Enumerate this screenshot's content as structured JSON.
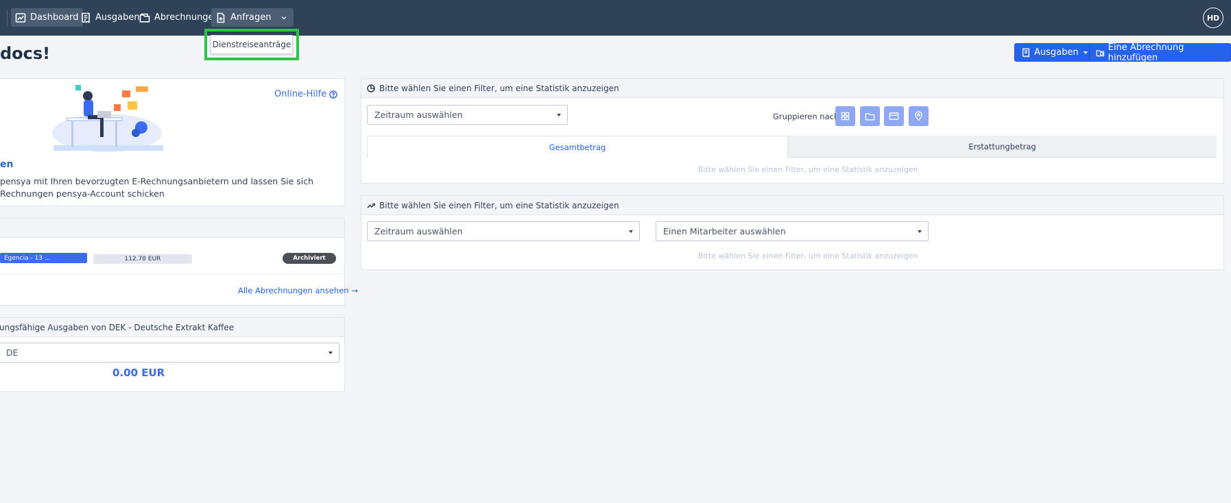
{
  "nav": {
    "items": [
      {
        "label": "Dashboard",
        "icon": "dashboard-icon"
      },
      {
        "label": "Ausgaben",
        "icon": "receipt-icon"
      },
      {
        "label": "Abrechnungen",
        "icon": "folder-icon"
      },
      {
        "label": "Anfragen",
        "icon": "document-plus-icon"
      }
    ],
    "avatar": "HD",
    "dropdown_item": "Dienstreiseanträge"
  },
  "page": {
    "title": "docs!",
    "expenses_button": "Ausgaben",
    "add_report_button": "Eine Abrechnung hinzufügen"
  },
  "einvoice": {
    "help_link": "Online-Hilfe",
    "title": "en",
    "text": "pensya mit Ihren bevorzugten E-Rechnungsanbietern und lassen Sie sich Rechnungen pensya-Account schicken"
  },
  "reports": {
    "row_name": "Egencia - 13 ...",
    "row_amount": "112.78 EUR",
    "row_status": "Archiviert",
    "all_link": "Alle Abrechnungen ansehen →"
  },
  "reimbursable": {
    "header": "ungsfähige Ausgaben von DEK - Deutsche Extrakt Kaffee",
    "select_value": "DE",
    "amount": "0.00 EUR"
  },
  "stats1": {
    "header": "Bitte wählen Sie einen Filter, um eine Statistik anzuzeigen",
    "period_select": "Zeitraum auswählen",
    "group_label": "Gruppieren nach:",
    "tabs": [
      "Gesamtbetrag",
      "Erstattungbetrag"
    ],
    "hint": "Bitte wählen Sie einen Filter, um eine Statistik anzuzeigen"
  },
  "stats2": {
    "header": "Bitte wählen Sie einen Filter, um eine Statistik anzuzeigen",
    "period_select": "Zeitraum auswählen",
    "employee_select": "Einen Mitarbeiter auswählen",
    "hint": "Bitte wählen Sie einen Filter, um eine Statistik anzuzeigen"
  },
  "colors": {
    "nav_bg": "#2f4258",
    "accent": "#2563eb",
    "highlight": "#2ec448"
  }
}
